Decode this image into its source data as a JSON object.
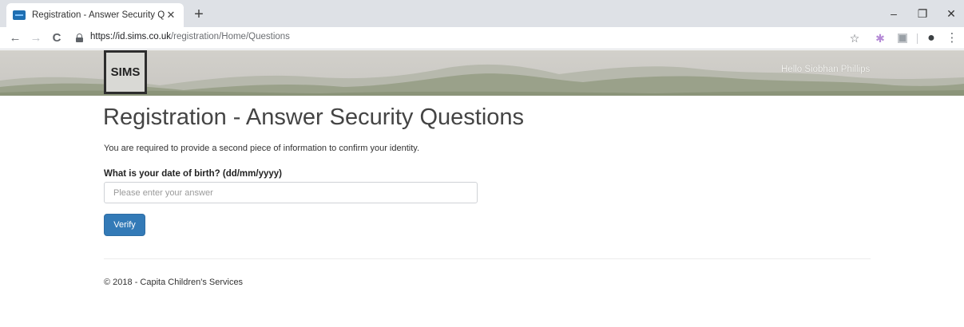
{
  "browser": {
    "tab_title": "Registration - Answer Security Q",
    "tab_close": "✕",
    "new_tab": "+",
    "url_host": "https://id.sims.co.uk",
    "url_path": "/registration/Home/Questions",
    "window_minimize": "–",
    "window_restore": "❐",
    "window_close": "✕"
  },
  "icons": {
    "back": "←",
    "forward": "→",
    "reload": "C",
    "bookmark": "☆",
    "extension": "✱",
    "account": "●",
    "menu": "⋮"
  },
  "header": {
    "logo_text": "SIMS",
    "greeting": "Hello Siobhan Phillips"
  },
  "main": {
    "title": "Registration - Answer Security Questions",
    "intro": "You are required to provide a second piece of information to confirm your identity.",
    "question_label": "What is your date of birth? (dd/mm/yyyy)",
    "answer_placeholder": "Please enter your answer",
    "answer_value": "",
    "verify_label": "Verify"
  },
  "footer": {
    "text": "© 2018 - Capita Children's Services"
  },
  "colors": {
    "primary_button": "#337ab7",
    "banner_bg": "#c9c7c2",
    "hills_dark": "#8b9479"
  }
}
